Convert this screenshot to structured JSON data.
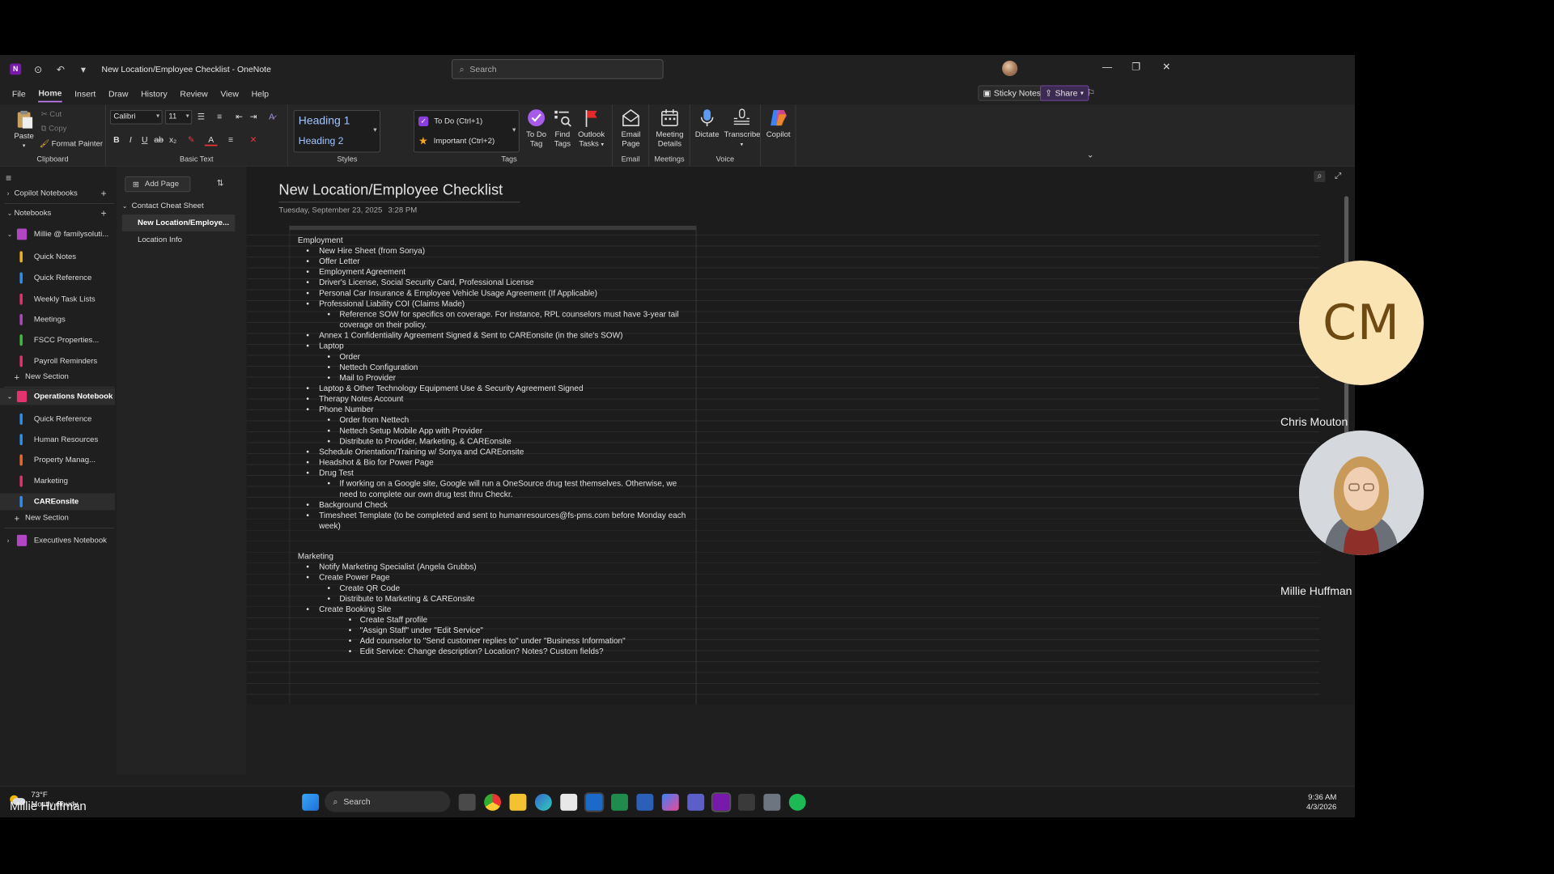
{
  "window": {
    "title": "New Location/Employee Checklist",
    "app": "OneNote",
    "search_placeholder": "Search"
  },
  "menu": [
    "File",
    "Home",
    "Insert",
    "Draw",
    "History",
    "Review",
    "View",
    "Help"
  ],
  "menu_active": "Home",
  "menu_right": {
    "sticky_notes": "Sticky Notes",
    "share": "Share"
  },
  "ribbon": {
    "clipboard": {
      "label": "Clipboard",
      "paste": "Paste",
      "cut": "Cut",
      "copy": "Copy",
      "format_painter": "Format Painter"
    },
    "basic_text": {
      "label": "Basic Text",
      "font": "Calibri",
      "size": "11"
    },
    "styles": {
      "label": "Styles",
      "h1": "Heading 1",
      "h2": "Heading 2"
    },
    "tags": {
      "label": "Tags",
      "todo": "To Do (Ctrl+1)",
      "important": "Important (Ctrl+2)",
      "todo_tag_1": "To Do",
      "todo_tag_2": "Tag",
      "find_1": "Find",
      "find_2": "Tags",
      "outlook_1": "Outlook",
      "outlook_2": "Tasks"
    },
    "email": {
      "label": "Email",
      "btn_1": "Email",
      "btn_2": "Page"
    },
    "meetings": {
      "label": "Meetings",
      "btn_1": "Meeting",
      "btn_2": "Details"
    },
    "voice": {
      "label": "Voice",
      "dictate": "Dictate",
      "transcribe": "Transcribe"
    },
    "copilot": "Copilot"
  },
  "nav": {
    "copilot_notebooks": "Copilot Notebooks",
    "notebooks": "Notebooks",
    "nb1": "Millie @ familysoluti...",
    "nb1_sections": [
      {
        "name": "Quick Notes",
        "color": "#f2b01e"
      },
      {
        "name": "Quick Reference",
        "color": "#2f8ee8"
      },
      {
        "name": "Weekly Task Lists",
        "color": "#e3336e"
      },
      {
        "name": "Meetings",
        "color": "#b146c2"
      },
      {
        "name": "FSCC Properties...",
        "color": "#3dbb3d"
      },
      {
        "name": "Payroll Reminders",
        "color": "#e3336e"
      }
    ],
    "new_section": "New Section",
    "nb2": "Operations Notebook",
    "nb2_sections": [
      {
        "name": "Quick Reference",
        "color": "#2f8ee8"
      },
      {
        "name": "Human Resources",
        "color": "#2f8ee8"
      },
      {
        "name": "Property Manag...",
        "color": "#e8682a"
      },
      {
        "name": "Marketing",
        "color": "#e3336e"
      },
      {
        "name": "CAREonsite",
        "color": "#2f8ee8"
      }
    ],
    "nb3": "Executives Notebook"
  },
  "pages": {
    "add_page": "Add Page",
    "group": "Contact Cheat Sheet",
    "selected": "New Location/Employe...",
    "other": "Location Info"
  },
  "note": {
    "title": "New Location/Employee Checklist",
    "date": "Tuesday, September 23, 2025",
    "time": "3:28 PM",
    "employment_heading": "Employment",
    "employment": [
      {
        "level": 1,
        "text": "New Hire Sheet (from Sonya)"
      },
      {
        "level": 1,
        "text": "Offer Letter"
      },
      {
        "level": 1,
        "text": "Employment Agreement"
      },
      {
        "level": 1,
        "text": "Driver's License, Social Security Card, Professional License"
      },
      {
        "level": 1,
        "text": "Personal Car Insurance & Employee Vehicle Usage Agreement (If Applicable)"
      },
      {
        "level": 1,
        "text": "Professional Liability COI (Claims Made)"
      },
      {
        "level": 2,
        "text": "Reference SOW for specifics on coverage. For instance, RPL counselors must have 3-year tail coverage on their policy."
      },
      {
        "level": 1,
        "text": "Annex 1 Confidentiality Agreement Signed & Sent to CAREonsite (in the site's SOW)"
      },
      {
        "level": 1,
        "text": "Laptop"
      },
      {
        "level": 2,
        "text": "Order"
      },
      {
        "level": 2,
        "text": "Nettech Configuration"
      },
      {
        "level": 2,
        "text": "Mail to Provider"
      },
      {
        "level": 1,
        "text": "Laptop & Other Technology Equipment Use & Security Agreement Signed"
      },
      {
        "level": 1,
        "text": "Therapy Notes Account"
      },
      {
        "level": 1,
        "text": "Phone Number"
      },
      {
        "level": 2,
        "text": "Order from Nettech"
      },
      {
        "level": 2,
        "text": "Nettech Setup Mobile App with Provider"
      },
      {
        "level": 2,
        "text": "Distribute to Provider, Marketing, & CAREonsite"
      },
      {
        "level": 1,
        "text": "Schedule Orientation/Training w/ Sonya and CAREonsite"
      },
      {
        "level": 1,
        "text": "Headshot & Bio for Power Page"
      },
      {
        "level": 1,
        "text": "Drug Test"
      },
      {
        "level": 2,
        "text": "If working on a Google site, Google will run a OneSource drug test themselves. Otherwise, we need to complete our own drug test thru Checkr."
      },
      {
        "level": 1,
        "text": "Background Check"
      },
      {
        "level": 1,
        "text": "Timesheet Template (to be completed and sent to humanresources@fs-pms.com before Monday each week)"
      }
    ],
    "marketing_heading": "Marketing",
    "marketing": [
      {
        "level": 1,
        "text": "Notify Marketing Specialist (Angela Grubbs)"
      },
      {
        "level": 1,
        "text": "Create Power Page"
      },
      {
        "level": 2,
        "text": "Create QR Code"
      },
      {
        "level": 2,
        "text": "Distribute to Marketing & CAREonsite"
      },
      {
        "level": 1,
        "text": "Create Booking Site"
      },
      {
        "level": 3,
        "text": "Create Staff profile"
      },
      {
        "level": 3,
        "text": "\"Assign Staff\" under \"Edit Service\""
      },
      {
        "level": 3,
        "text": "Add counselor to \"Send customer replies to\" under \"Business Information\""
      },
      {
        "level": 3,
        "text": "Edit Service: Change description? Location? Notes? Custom fields?"
      }
    ]
  },
  "taskbar": {
    "temp": "73°F",
    "weather": "Mostly cloudy",
    "search": "Search",
    "time": "9:36 AM",
    "date": "4/3/2026"
  },
  "participants": {
    "p1_initials": "CM",
    "p1_name": "Chris Mouton",
    "p2_name": "Millie Huffman",
    "presenter": "Millie Huffman"
  }
}
